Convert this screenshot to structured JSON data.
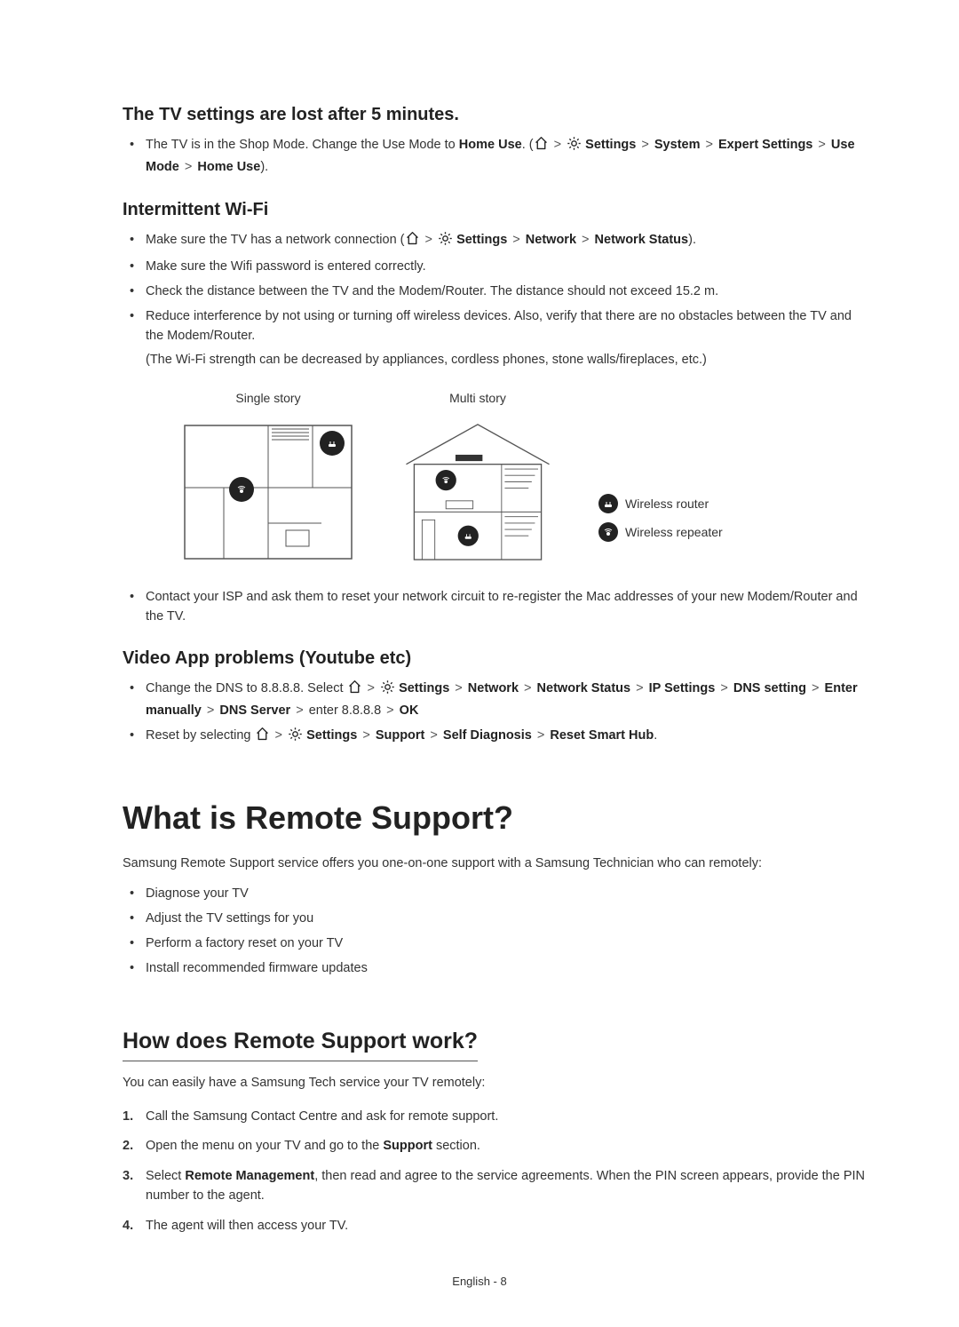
{
  "section1": {
    "heading": "The TV settings are lost after 5 minutes.",
    "bullets": [
      {
        "pre": "The TV is in the Shop Mode. Change the Use Mode to ",
        "b1": "Home Use",
        "mid": ". (",
        "path": [
          "Settings",
          "System",
          "Expert Settings",
          "Use Mode",
          "Home Use"
        ],
        "post": ")."
      }
    ]
  },
  "section2": {
    "heading": "Intermittent Wi-Fi",
    "b0": {
      "pre": "Make sure the TV has a network connection (",
      "path": [
        "Settings",
        "Network",
        "Network Status"
      ],
      "post": ")."
    },
    "b1": "Make sure the Wifi password is entered correctly.",
    "b2": "Check the distance between the TV and the Modem/Router. The distance should not exceed 15.2 m.",
    "b3": "Reduce interference by not using or turning off wireless devices. Also, verify that there are no obstacles between the TV and the Modem/Router.",
    "b3sub": "(The Wi-Fi strength can be decreased by appliances, cordless phones, stone walls/fireplaces, etc.)",
    "dia1_title": "Single story",
    "dia2_title": "Multi story",
    "legend1": "Wireless router",
    "legend2": "Wireless repeater",
    "b4": "Contact your ISP and ask them to reset your network circuit to re-register the Mac addresses of your new Modem/Router and the TV."
  },
  "section3": {
    "heading": "Video App problems (Youtube etc)",
    "b0": {
      "pre": "Change the DNS to 8.8.8.8. Select ",
      "path": [
        "Settings",
        "Network",
        "Network Status",
        "IP Settings",
        "DNS setting",
        "Enter manually",
        "DNS Server"
      ],
      "tail_plain": "enter 8.8.8.8",
      "tail_bold": "OK"
    },
    "b1": {
      "pre": "Reset by selecting ",
      "path": [
        "Settings",
        "Support",
        "Self Diagnosis",
        "Reset Smart Hub"
      ],
      "post": "."
    }
  },
  "section4": {
    "heading": "What is Remote Support?",
    "intro": "Samsung Remote Support service offers you one-on-one support with a Samsung Technician who can remotely:",
    "bullets": [
      "Diagnose your TV",
      "Adjust the TV settings for you",
      "Perform a factory reset on your TV",
      "Install recommended firmware updates"
    ]
  },
  "section5": {
    "heading": "How does Remote Support work?",
    "intro": "You can easily have a Samsung Tech service your TV remotely:",
    "steps": {
      "s1": "Call the Samsung Contact Centre and ask for remote support.",
      "s2_pre": "Open the menu on your TV and go to the ",
      "s2_bold": "Support",
      "s2_post": " section.",
      "s3_pre": "Select ",
      "s3_bold": "Remote Management",
      "s3_post": ", then read and agree to the service agreements. When the PIN screen appears, provide the PIN number to the agent.",
      "s4": "The agent will then access your TV."
    }
  },
  "footer": "English - 8",
  "glyph": {
    "sep": ">"
  }
}
